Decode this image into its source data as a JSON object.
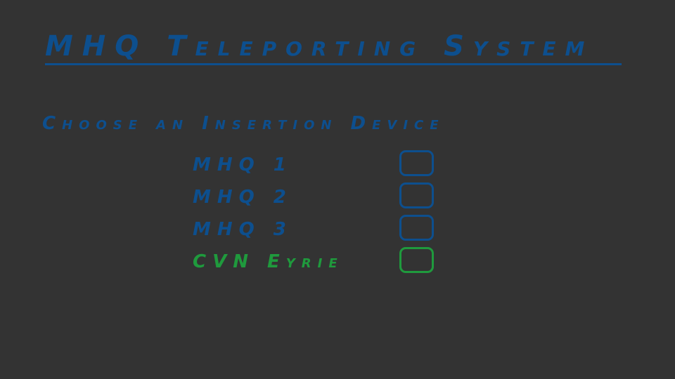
{
  "title": "MHQ Teleporting System",
  "subtitle": "Choose an Insertion Device",
  "options": [
    {
      "label": "MHQ 1",
      "selected": false
    },
    {
      "label": "MHQ 2",
      "selected": false
    },
    {
      "label": "MHQ 3",
      "selected": false
    },
    {
      "label": "CVN Eyrie",
      "selected": true
    }
  ],
  "colors": {
    "background": "#333333",
    "accent_blue": "#0d4f8e",
    "selected_green": "#1f9a3d"
  }
}
